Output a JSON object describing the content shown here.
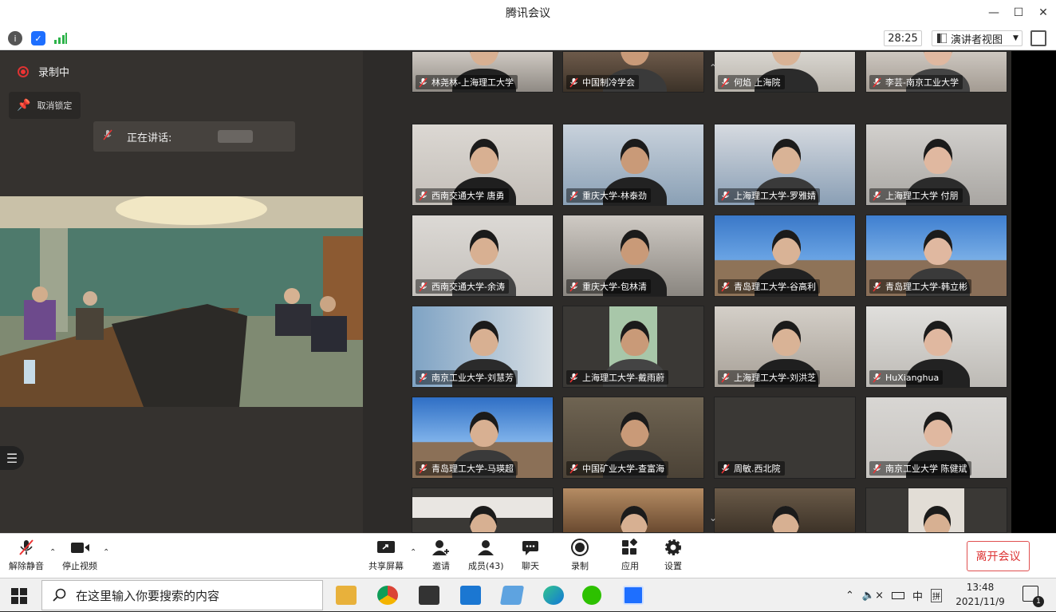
{
  "window": {
    "title": "腾讯会议"
  },
  "infobar": {
    "timer": "28:25",
    "view_label": "演讲者视图"
  },
  "left": {
    "recording_label": "录制中",
    "unlock_label": "取消锁定",
    "speaking_label": "正在讲话:"
  },
  "participants": [
    {
      "name": "林尧林-上海理工大学"
    },
    {
      "name": "中国制冷学会"
    },
    {
      "name": "何焰 上海院"
    },
    {
      "name": "李芸-南京工业大学"
    },
    {
      "name": "西南交通大学 唐勇"
    },
    {
      "name": "重庆大学-林泰劲"
    },
    {
      "name": "上海理工大学-罗雅婧"
    },
    {
      "name": "上海理工大学 付朋"
    },
    {
      "name": "西南交通大学-余涛"
    },
    {
      "name": "重庆大学-包林清"
    },
    {
      "name": "青岛理工大学-谷高利"
    },
    {
      "name": "青岛理工大学-韩立彬"
    },
    {
      "name": "南京工业大学-刘慧芳"
    },
    {
      "name": "上海理工大学-戴雨蔚"
    },
    {
      "name": "上海理工大学-刘洪芝"
    },
    {
      "name": "HuXianghua"
    },
    {
      "name": "青岛理工大学-马瑛超"
    },
    {
      "name": "中国矿业大学-查富海"
    },
    {
      "name": "周敏.西北院"
    },
    {
      "name": "南京工业大学 陈健斌"
    }
  ],
  "toolbar": {
    "unmute": "解除静音",
    "stop_video": "停止视频",
    "share": "共享屏幕",
    "invite": "邀请",
    "members": "成员(43)",
    "chat": "聊天",
    "record": "录制",
    "apps": "应用",
    "settings": "设置",
    "leave": "离开会议"
  },
  "taskbar": {
    "search_placeholder": "在这里输入你要搜索的内容",
    "ime": "中",
    "ime2": "拼",
    "time": "13:48",
    "date": "2021/11/9",
    "notif_count": "1"
  },
  "colors": {
    "accent": "#1e6fff",
    "leave": "#d33333",
    "record": "#e33333"
  }
}
